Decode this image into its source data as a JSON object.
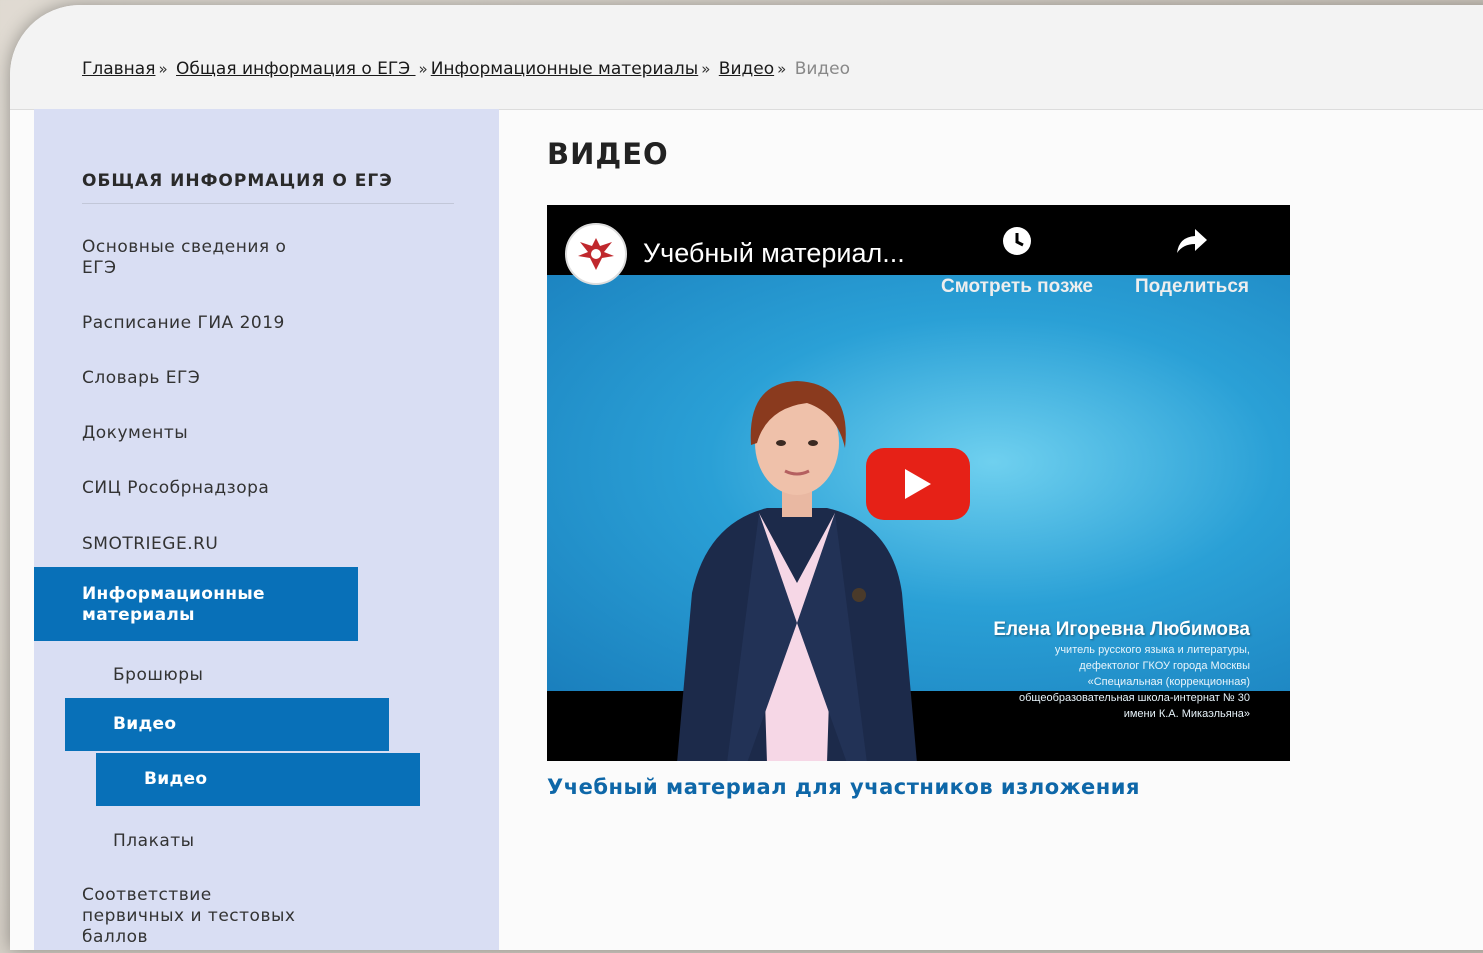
{
  "breadcrumb": {
    "items": [
      "Главная",
      "Общая информация о ЕГЭ ",
      "Информационные материалы",
      "Видео"
    ],
    "separator": "»",
    "current": "Видео"
  },
  "sidebar": {
    "title": "ОБЩАЯ ИНФОРМАЦИЯ О ЕГЭ",
    "items": [
      "Основные сведения о\nЕГЭ",
      "Расписание ГИА 2019",
      "Словарь ЕГЭ",
      "Документы",
      "СИЦ Рособрнадзора",
      "SMOTRIEGE.RU",
      "Информационные\nматериалы",
      "Брошюры",
      "Видео",
      "Видео",
      "Плакаты",
      "Соответствие\nпервичных и тестовых\nбаллов"
    ]
  },
  "main": {
    "title": "ВИДЕО",
    "video": {
      "title": "Учебный материал...",
      "watch_later": "Смотреть позже",
      "share": "Поделиться",
      "caption_name": "Елена Игоревна Любимова",
      "caption_lines": [
        "учитель русского языка и литературы,",
        "дефектолог ГКОУ города Москвы",
        "«Специальная (коррекционная)",
        "общеобразовательная школа-интернат № 30",
        "имени К.А. Микаэльяна»"
      ]
    },
    "link": "Учебный материал для участников изложения"
  },
  "colors": {
    "accent": "#0870b8",
    "sidebar_bg": "#d9def3",
    "link": "#0e67a8",
    "youtube_red": "#e62117"
  }
}
